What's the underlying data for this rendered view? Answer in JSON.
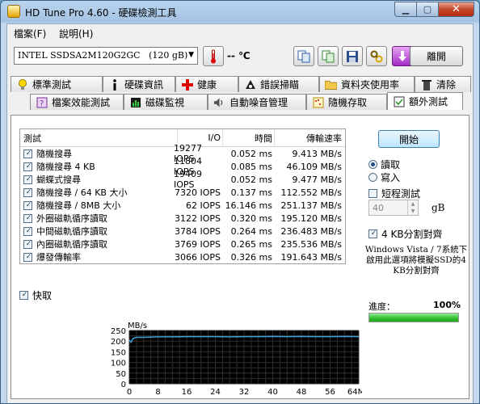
{
  "window": {
    "title": "HD Tune Pro 4.60 - 硬碟檢測工具"
  },
  "menu": [
    {
      "label": "檔案(F)"
    },
    {
      "label": "說明(H)"
    }
  ],
  "toolbar": {
    "drive": "INTEL SSDSA2M120G2GC",
    "drive_size": "(120 gB)",
    "temperature": "-- ℃",
    "exit_label": "離開"
  },
  "tabs_row1": [
    {
      "label": "標準測試",
      "icon": "bulb-icon"
    },
    {
      "label": "硬碟資訊",
      "icon": "info-icon"
    },
    {
      "label": "健康",
      "icon": "health-cross-icon"
    },
    {
      "label": "錯誤掃瞄",
      "icon": "scan-icon"
    },
    {
      "label": "資料夾使用率",
      "icon": "folder-icon"
    },
    {
      "label": "清除",
      "icon": "trash-icon"
    }
  ],
  "tabs_row2": [
    {
      "label": "檔案效能測試",
      "icon": "file-benchmark-icon"
    },
    {
      "label": "磁碟監視",
      "icon": "monitor-icon"
    },
    {
      "label": "自動噪音管理",
      "icon": "speaker-icon"
    },
    {
      "label": "隨機存取",
      "icon": "random-access-icon"
    },
    {
      "label": "額外測試",
      "icon": "extra-test-icon",
      "active": true
    }
  ],
  "results": {
    "headers": [
      "測試",
      "I/O",
      "時間",
      "傳輸速率"
    ],
    "rows": [
      {
        "name": "隨機搜尋",
        "io": "19277 IOPS",
        "time": "0.052 ms",
        "rate": "9.413 MB/s"
      },
      {
        "name": "隨機搜尋 4 KB",
        "io": "11804 IOPS",
        "time": "0.085 ms",
        "rate": "46.109 MB/s"
      },
      {
        "name": "蝴蝶式搜尋",
        "io": "19409 IOPS",
        "time": "0.052 ms",
        "rate": "9.477 MB/s"
      },
      {
        "name": "隨機搜尋 / 64 KB 大小",
        "io": "7320 IOPS",
        "time": "0.137 ms",
        "rate": "112.552 MB/s"
      },
      {
        "name": "隨機搜尋 / 8MB 大小",
        "io": "62 IOPS",
        "time": "16.146 ms",
        "rate": "251.137 MB/s"
      },
      {
        "name": "外圈磁軌循序讀取",
        "io": "3122 IOPS",
        "time": "0.320 ms",
        "rate": "195.120 MB/s"
      },
      {
        "name": "中間磁軌循序讀取",
        "io": "3784 IOPS",
        "time": "0.264 ms",
        "rate": "236.483 MB/s"
      },
      {
        "name": "內圈磁軌循序讀取",
        "io": "3769 IOPS",
        "time": "0.265 ms",
        "rate": "235.536 MB/s"
      },
      {
        "name": "爆發傳輸率",
        "io": "3066 IOPS",
        "time": "0.326 ms",
        "rate": "191.643 MB/s"
      }
    ]
  },
  "quick_label": "快取",
  "right": {
    "start_label": "開始",
    "read_label": "讀取",
    "write_label": "寫入",
    "short_test_label": "短程測試",
    "short_value": "40",
    "gb_label": "gB",
    "align_label": "4 KB分割對齊",
    "vista_note": "Windows Vista / 7系統下啟用此選項將模擬SSD的4 KB分割對齊",
    "progress_label": "進度：",
    "progress_value": "100%",
    "progress_fraction": 1.0
  },
  "chart_data": {
    "type": "line",
    "ylabel": "MB/s",
    "xlabel": "",
    "x_ticks": [
      "0",
      "8",
      "16",
      "24",
      "32",
      "40",
      "48",
      "56",
      "64MB"
    ],
    "y_ticks": [
      "0",
      "50",
      "100",
      "150",
      "200",
      "250"
    ],
    "xlim": [
      0,
      64
    ],
    "ylim": [
      0,
      250
    ],
    "x": [
      0,
      0.5,
      1,
      2,
      4,
      8,
      12,
      16,
      20,
      24,
      28,
      32,
      36,
      40,
      44,
      48,
      52,
      56,
      60,
      64
    ],
    "values": [
      205,
      195,
      212,
      218,
      218,
      220,
      220,
      221,
      221,
      221,
      220,
      221,
      221,
      222,
      221,
      222,
      221,
      221,
      222,
      221
    ],
    "grid": true,
    "background": "#000000",
    "line_color": "#3ea1da",
    "grid_color": "#2e2e2e"
  }
}
